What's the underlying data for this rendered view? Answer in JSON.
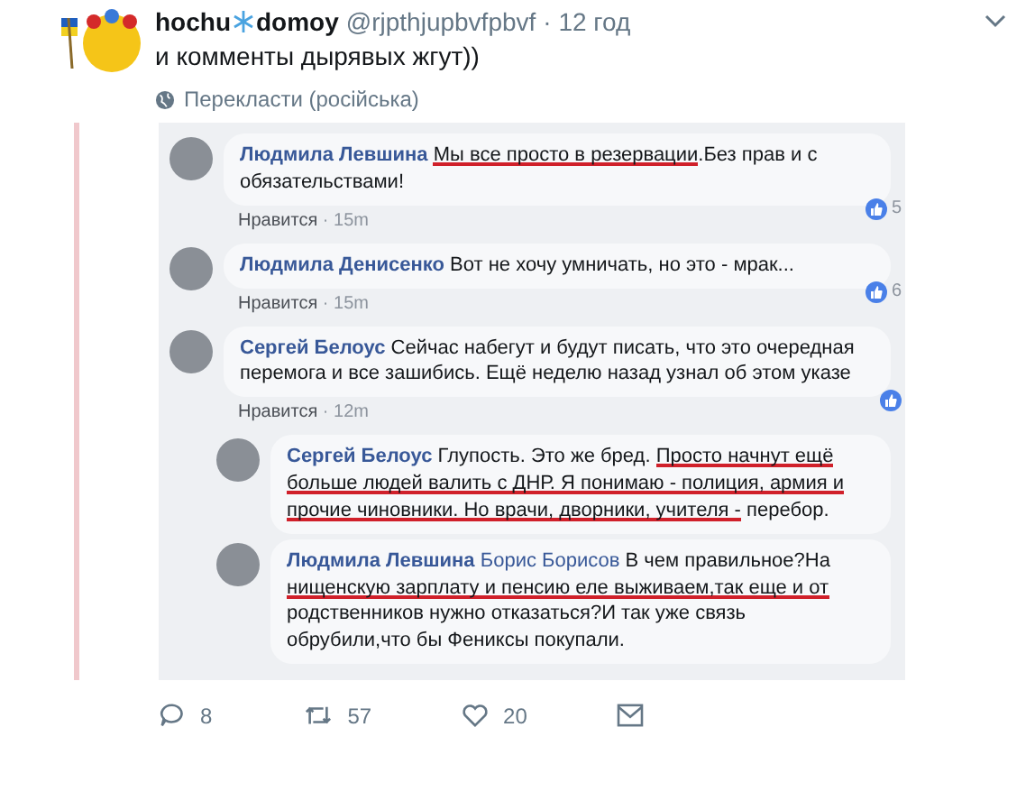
{
  "tweet": {
    "display_name": "hochu",
    "name_suffix": "domoy",
    "handle": "@rjpthjupbvfpbvf",
    "time": "· 12 год",
    "text": "и комменты дырявых жгут))",
    "translate": "Перекласти (російська)"
  },
  "comments": [
    {
      "author": "Людмила Левшина",
      "reply": false,
      "segments": [
        {
          "text": "Мы все просто в резервации",
          "underlined": true
        },
        {
          "text": ".Без прав и с обязательствами!",
          "underlined": false
        }
      ],
      "like": "Нравится",
      "time": "· 15m",
      "reactions": "5"
    },
    {
      "author": "Людмила Денисенко",
      "reply": false,
      "segments": [
        {
          "text": "Вот не хочу умничать, но это - мрак...",
          "underlined": false
        }
      ],
      "like": "Нравится",
      "time": "· 15m",
      "reactions": "6"
    },
    {
      "author": "Сергей Белоус",
      "reply": false,
      "segments": [
        {
          "text": "Сейчас набегут и будут писать, что это очередная перемога и все зашибись. Ещё неделю назад узнал об этом указе",
          "underlined": false
        }
      ],
      "like": "Нравится",
      "time": "· 12m"
    },
    {
      "author": "Сергей Белоус",
      "reply": true,
      "segments": [
        {
          "text": "Глупость. Это же бред. ",
          "underlined": false
        },
        {
          "text": "Просто начнут ещё больше людей валить с ДНР. Я понимаю - полиция, армия и прочие чиновники. Но врачи, дворники, учителя -",
          "underlined": true
        },
        {
          "text": " перебор.",
          "underlined": false
        }
      ]
    },
    {
      "author": "Людмила Левшина",
      "reply": true,
      "mention": "Борис Борисов",
      "segments": [
        {
          "text": "В чем правильное?На ",
          "underlined": false
        },
        {
          "text": "нищенскую зарплату и пенсию еле выживаем,так еще и от",
          "underlined": true
        },
        {
          "text": " родственников нужно отказаться?И так уже связь обрубили,что бы Фениксы покупали.",
          "underlined": false
        }
      ]
    }
  ],
  "actions": {
    "replies": "8",
    "retweets": "57",
    "likes": "20"
  }
}
